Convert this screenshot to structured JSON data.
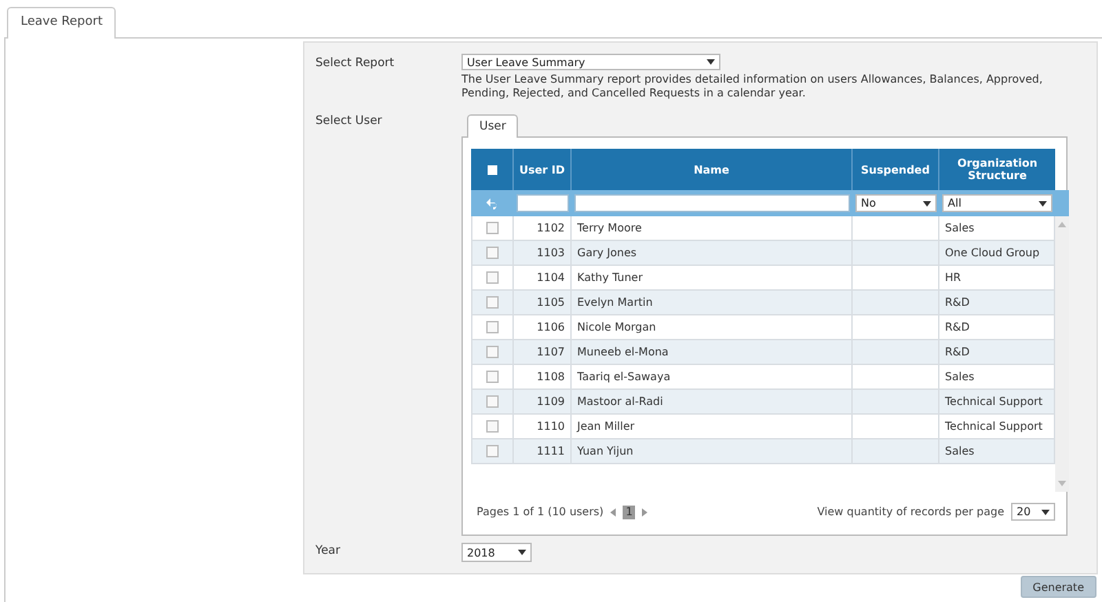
{
  "tabs": [
    {
      "label": "Leave Report",
      "selected": true
    }
  ],
  "select_report": {
    "label": "Select Report",
    "value": "User Leave Summary",
    "description": "The User Leave Summary report provides detailed information on users Allowances, Balances, Approved, Pending, Rejected, and Cancelled Requests in a calendar year."
  },
  "select_user": {
    "label": "Select User",
    "tabs": [
      {
        "label": "User",
        "selected": true
      }
    ],
    "table": {
      "header_checkbox": {
        "checked": false
      },
      "columns": [
        "User ID",
        "Name",
        "Suspended",
        "Organization Structure"
      ],
      "filters": {
        "suspended": "No",
        "organization": "All"
      },
      "rows": [
        {
          "checked": false,
          "user_id": "1102",
          "name": "Terry Moore",
          "organization": "Sales"
        },
        {
          "checked": false,
          "user_id": "1103",
          "name": "Gary Jones",
          "organization": "One Cloud Group"
        },
        {
          "checked": false,
          "user_id": "1104",
          "name": "Kathy Tuner",
          "organization": "HR"
        },
        {
          "checked": false,
          "user_id": "1105",
          "name": "Evelyn Martin",
          "organization": "R&D"
        },
        {
          "checked": false,
          "user_id": "1106",
          "name": "Nicole Morgan",
          "organization": "R&D"
        },
        {
          "checked": false,
          "user_id": "1107",
          "name": "Muneeb el-Mona",
          "organization": "R&D"
        },
        {
          "checked": false,
          "user_id": "1108",
          "name": "Taariq el-Sawaya",
          "organization": "Sales"
        },
        {
          "checked": false,
          "user_id": "1109",
          "name": "Mastoor al-Radi",
          "organization": "Technical Support"
        },
        {
          "checked": false,
          "user_id": "1110",
          "name": "Jean Miller",
          "organization": "Technical Support"
        },
        {
          "checked": false,
          "user_id": "1111",
          "name": "Yuan Yijun",
          "organization": "Sales"
        }
      ]
    },
    "pager": {
      "summary": "Pages 1 of 1 (10 users)",
      "pages": [
        {
          "label": "1",
          "selected": true
        }
      ],
      "per_page_label": "View quantity of records per page",
      "per_page": "20"
    }
  },
  "year": {
    "label": "Year",
    "value": "2018"
  },
  "button": "Generate"
}
